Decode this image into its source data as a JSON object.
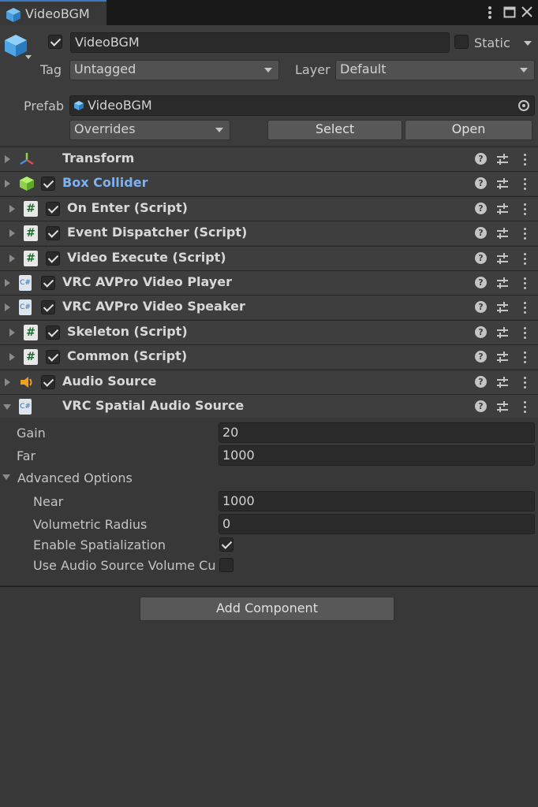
{
  "window": {
    "tab_title": "VideoBGM",
    "menu_icon": "kebab-icon",
    "maximize_icon": "maximize-icon",
    "close_icon": "close-icon"
  },
  "header": {
    "object_name": "VideoBGM",
    "active": true,
    "static_label": "Static",
    "static_checked": false,
    "tag_label": "Tag",
    "tag_value": "Untagged",
    "layer_label": "Layer",
    "layer_value": "Default",
    "prefab_label": "Prefab",
    "prefab_value": "VideoBGM",
    "overrides_label": "Overrides",
    "select_label": "Select",
    "open_label": "Open"
  },
  "components": [
    {
      "name": "Transform",
      "icon": "transform-icon",
      "checkbox": false
    },
    {
      "name": "Box Collider",
      "icon": "box-collider-icon",
      "checkbox": true,
      "checked": true,
      "highlight": true
    },
    {
      "name": "On Enter (Script)",
      "icon": "script-icon",
      "checkbox": true,
      "checked": true
    },
    {
      "name": "Event Dispatcher (Script)",
      "icon": "script-icon",
      "checkbox": true,
      "checked": true
    },
    {
      "name": "Video Execute (Script)",
      "icon": "script-icon",
      "checkbox": true,
      "checked": true
    },
    {
      "name": "VRC AVPro Video Player",
      "icon": "cs-file-icon",
      "checkbox": true,
      "checked": true
    },
    {
      "name": "VRC AVPro Video Speaker",
      "icon": "cs-file-icon",
      "checkbox": true,
      "checked": true
    },
    {
      "name": "Skeleton (Script)",
      "icon": "script-icon",
      "checkbox": true,
      "checked": true
    },
    {
      "name": "Common (Script)",
      "icon": "script-icon",
      "checkbox": true,
      "checked": true
    },
    {
      "name": "Audio Source",
      "icon": "audio-source-icon",
      "checkbox": true,
      "checked": true
    },
    {
      "name": "VRC Spatial Audio Source",
      "icon": "cs-file-icon",
      "checkbox": false,
      "expanded": true
    }
  ],
  "spatial_audio": {
    "gain_label": "Gain",
    "gain_value": "20",
    "far_label": "Far",
    "far_value": "1000",
    "advanced_label": "Advanced Options",
    "near_label": "Near",
    "near_value": "1000",
    "volumetric_label": "Volumetric Radius",
    "volumetric_value": "0",
    "spatialization_label": "Enable Spatialization",
    "spatialization_checked": true,
    "use_volume_label": "Use Audio Source Volume Cu",
    "use_volume_checked": false
  },
  "footer": {
    "add_component_label": "Add Component"
  },
  "colors": {
    "accent": "#3a79bb",
    "highlight_text": "#7fb0f0",
    "panel_bg": "#383838",
    "header_bg": "#3c3c3c"
  }
}
